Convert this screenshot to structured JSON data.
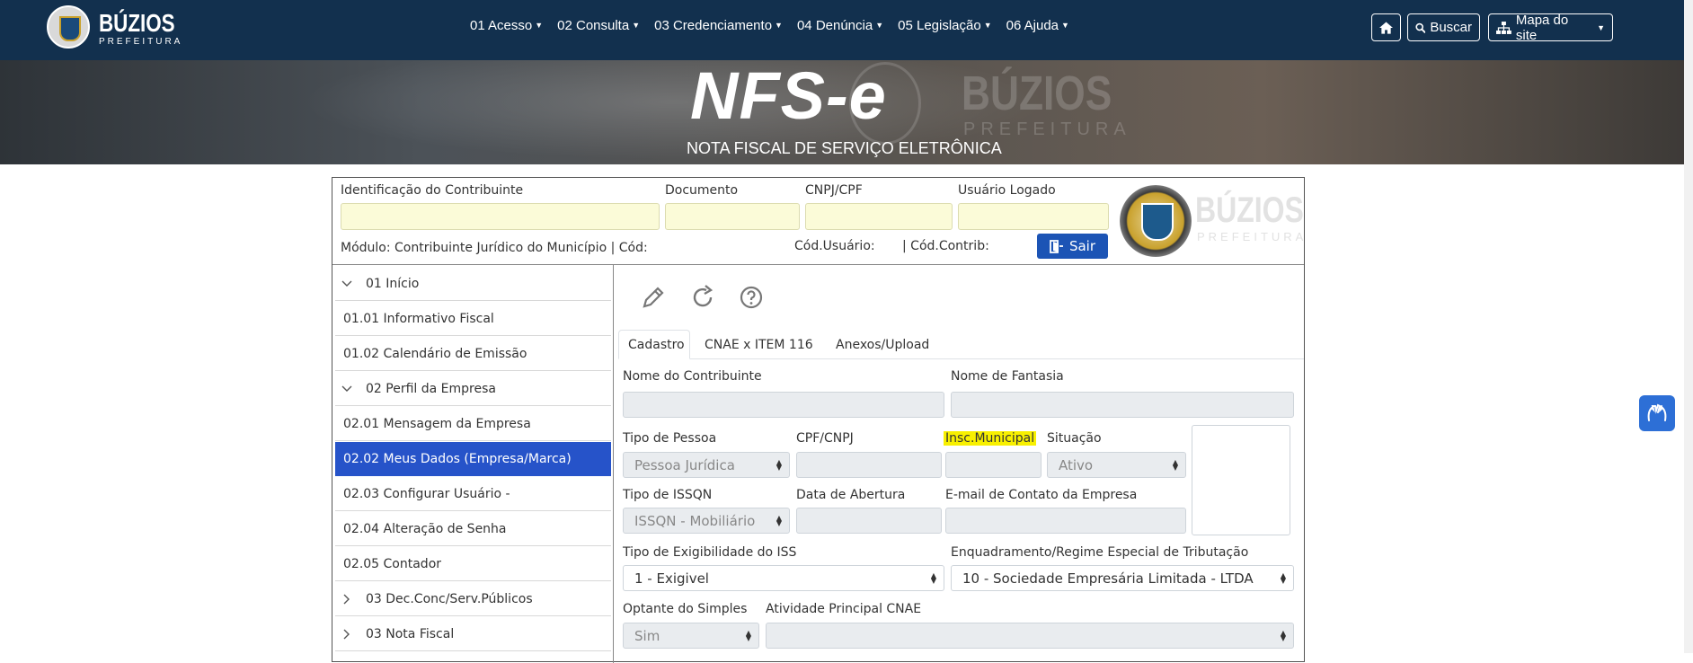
{
  "nav": {
    "logo_text": "BÚZIOS",
    "logo_sub": "PREFEITURA",
    "menu": [
      {
        "label": "01 Acesso"
      },
      {
        "label": "02 Consulta"
      },
      {
        "label": "03 Credenciamento"
      },
      {
        "label": "04 Denúncia"
      },
      {
        "label": "05 Legislação"
      },
      {
        "label": "06 Ajuda"
      }
    ],
    "buscar_label": "Buscar",
    "mapa_label": "Mapa do site"
  },
  "banner": {
    "title": "NFS-e",
    "subtitle": "NOTA FISCAL DE SERVIÇO ELETRÔNICA",
    "watermark": "BÚZIOS",
    "watermark_sub": "PREFEITURA"
  },
  "header": {
    "id_label": "Identificação do Contribuinte",
    "doc_label": "Documento",
    "cnpj_label": "CNPJ/CPF",
    "user_label": "Usuário Logado",
    "modulo": "Módulo: Contribuinte Jurídico do Município | Cód:",
    "cod_usuario": "Cód.Usuário:",
    "cod_contrib": "| Cód.Contrib:",
    "sair_label": "Sair",
    "logo_wm": "BÚZIOS",
    "logo_wm_sub": "PREFEITURA"
  },
  "sidebar": {
    "items": [
      {
        "label": "01 Início"
      },
      {
        "label": "01.01 Informativo Fiscal"
      },
      {
        "label": "01.02 Calendário de Emissão"
      },
      {
        "label": "02 Perfil da Empresa"
      },
      {
        "label": "02.01 Mensagem da Empresa"
      },
      {
        "label": "02.02 Meus Dados (Empresa/Marca)"
      },
      {
        "label": "02.03 Configurar Usuário -"
      },
      {
        "label": "02.04 Alteração de Senha"
      },
      {
        "label": "02.05 Contador"
      },
      {
        "label": "03 Dec.Conc/Serv.Públicos"
      },
      {
        "label": "03 Nota Fiscal"
      }
    ]
  },
  "tabs": [
    {
      "label": "Cadastro"
    },
    {
      "label": "CNAE x ITEM 116"
    },
    {
      "label": "Anexos/Upload"
    }
  ],
  "form": {
    "nome_contrib_label": "Nome do Contribuinte",
    "nome_fantasia_label": "Nome de Fantasia",
    "tipo_pessoa_label": "Tipo de Pessoa",
    "tipo_pessoa_value": "Pessoa Jurídica",
    "cpf_cnpj_label": "CPF/CNPJ",
    "insc_municipal_label": "Insc.Municipal",
    "situacao_label": "Situação",
    "situacao_value": "Ativo",
    "tipo_issqn_label": "Tipo de ISSQN",
    "tipo_issqn_value": "ISSQN - Mobiliário",
    "data_abertura_label": "Data de Abertura",
    "email_label": "E-mail de Contato da Empresa",
    "exigibilidade_label": "Tipo de Exigibilidade do ISS",
    "exigibilidade_value": "1 - Exigivel",
    "enquadramento_label": "Enquadramento/Regime Especial de Tributação",
    "enquadramento_value": "10 - Sociedade Empresária Limitada - LTDA",
    "simples_label": "Optante do Simples",
    "simples_value": "Sim",
    "cnae_label": "Atividade Principal CNAE"
  },
  "colors": {
    "nav_bg": "#12304e",
    "active_item": "#2653c9",
    "sair_btn": "#1c54b5",
    "highlight": "#f8f000"
  }
}
